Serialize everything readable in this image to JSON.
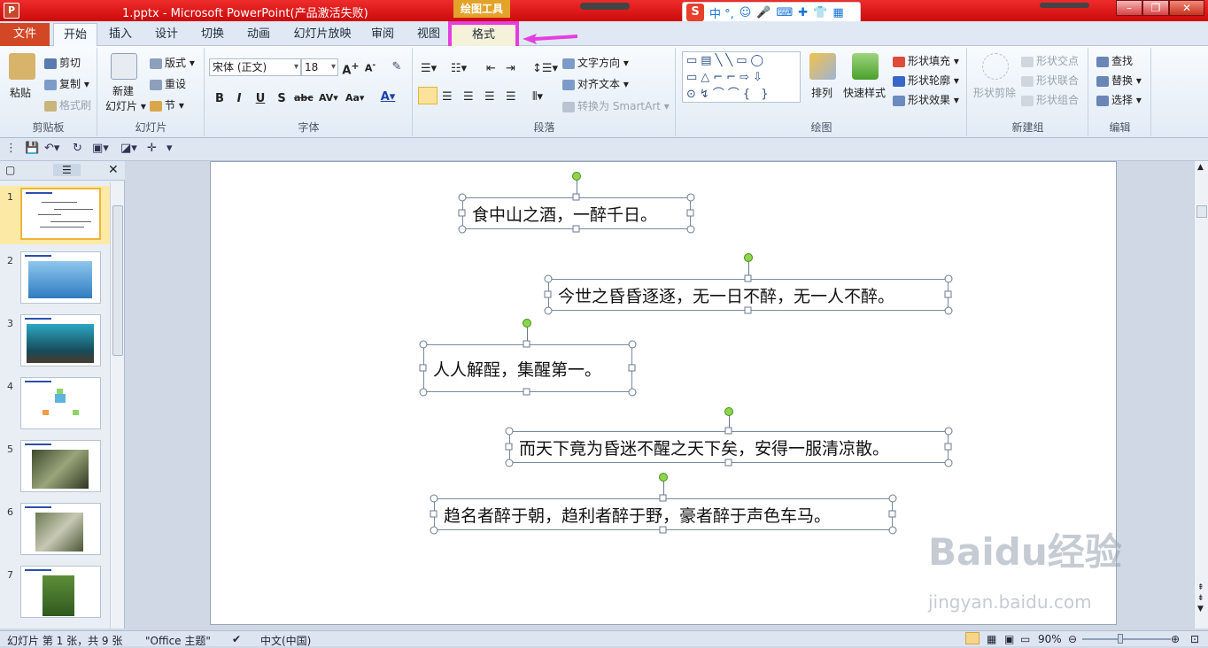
{
  "titlebar": {
    "title": "1.pptx  -  Microsoft PowerPoint(产品激活失败)",
    "context_tools": "绘图工具",
    "ime_label": "中 °,"
  },
  "tabs": {
    "file": "文件",
    "items": [
      "开始",
      "插入",
      "设计",
      "切换",
      "动画",
      "幻灯片放映",
      "审阅",
      "视图",
      "格式"
    ]
  },
  "ribbon": {
    "clipboard": {
      "paste": "粘贴",
      "cut": "剪切",
      "copy": "复制",
      "format_painter": "格式刷",
      "label": "剪贴板"
    },
    "slides": {
      "new_slide": "新建",
      "new_slide2": "幻灯片",
      "layout": "版式",
      "reset": "重设",
      "section": "节",
      "label": "幻灯片"
    },
    "font": {
      "font_name": "宋体 (正文)",
      "font_size": "18",
      "label": "字体"
    },
    "paragraph": {
      "text_direction": "文字方向",
      "align_text": "对齐文本",
      "smartart": "转换为 SmartArt",
      "label": "段落"
    },
    "drawing": {
      "arrange": "排列",
      "quick_styles": "快速样式",
      "shape_fill": "形状填充",
      "shape_outline": "形状轮廓",
      "shape_effects": "形状效果",
      "label": "绘图"
    },
    "new_group": {
      "shape_clip": "形状剪除",
      "shape_intersect": "形状交点",
      "shape_union": "形状联合",
      "shape_combine": "形状组合",
      "label": "新建组"
    },
    "editing": {
      "find": "查找",
      "replace": "替换",
      "select": "选择",
      "label": "编辑"
    }
  },
  "slide_texts": [
    "食中山之酒，一醉千日。",
    "今世之昏昏逐逐，无一日不醉，无一人不醉。",
    "人人解酲，集醒第一。",
    "而天下竟为昏迷不醒之天下矣，安得一服清凉散。",
    "趋名者醉于朝，趋利者醉于野，豪者醉于声色车马。"
  ],
  "thumbnails": [
    "1",
    "2",
    "3",
    "4",
    "5",
    "6",
    "7"
  ],
  "watermark": {
    "main": "Baidu经验",
    "sub": "jingyan.baidu.com"
  },
  "status": {
    "slide_info": "幻灯片 第 1 张，共 9 张",
    "theme": "\"Office 主题\"",
    "language": "中文(中国)",
    "zoom": "90%"
  }
}
